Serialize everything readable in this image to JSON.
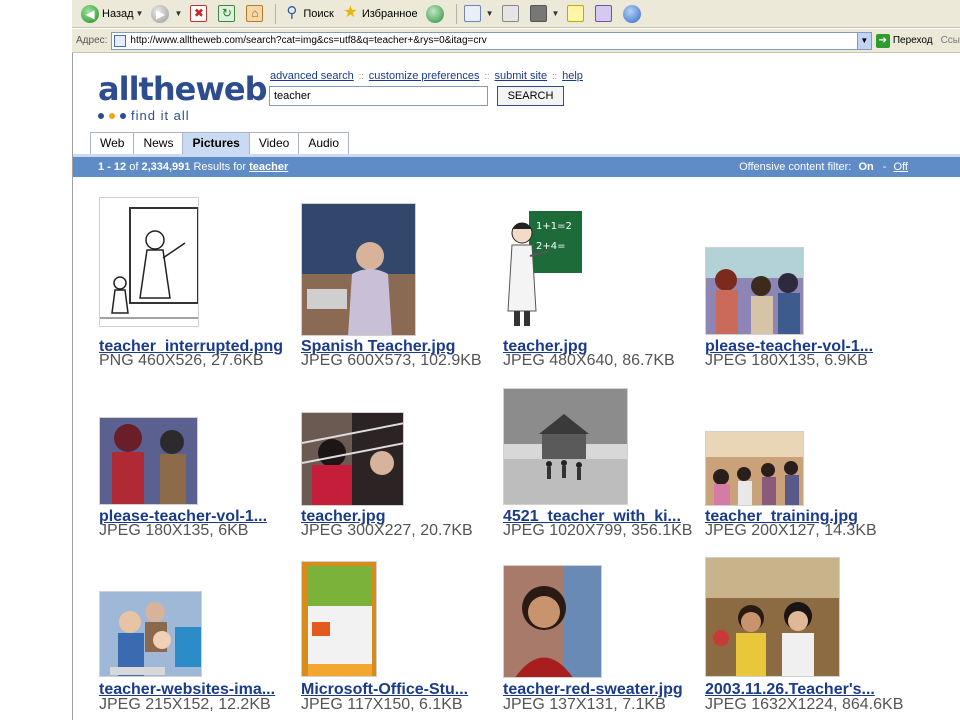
{
  "browser": {
    "back_label": "Назад",
    "search_label": "Поиск",
    "favorites_label": "Избранное",
    "address_label": "Адрес:",
    "url": "http://www.alltheweb.com/search?cat=img&cs=utf8&q=teacher+&rys=0&itag=crv",
    "go_label": "Переход",
    "links_label": "Ссы"
  },
  "header": {
    "logo_text": "alltheweb",
    "tagline": "find it all",
    "links": [
      "advanced search",
      "customize preferences",
      "submit site",
      "help"
    ],
    "search_value": "teacher",
    "search_button": "SEARCH"
  },
  "tabs": [
    {
      "label": "Web",
      "active": false
    },
    {
      "label": "News",
      "active": false
    },
    {
      "label": "Pictures",
      "active": true
    },
    {
      "label": "Video",
      "active": false
    },
    {
      "label": "Audio",
      "active": false
    }
  ],
  "resultbar": {
    "range": "1 - 12",
    "of_text": "of",
    "total": "2,334,991",
    "results_for": "Results for",
    "query": "teacher",
    "filter_label": "Offensive content filter:",
    "filter_on": "On",
    "filter_dash": "-",
    "filter_off": "Off"
  },
  "colors": {
    "brand": "#2d4d8f",
    "result_bar": "#5f8bc7",
    "tab_active": "#c9daf2",
    "link": "#1a3b8b"
  },
  "results": [
    {
      "name": "teacher_interrupted.png",
      "meta": "PNG 460X526, 27.6KB"
    },
    {
      "name": "Spanish Teacher.jpg",
      "meta": "JPEG 600X573, 102.9KB"
    },
    {
      "name": "teacher.jpg",
      "meta": "JPEG 480X640, 86.7KB"
    },
    {
      "name": "please-teacher-vol-1...",
      "meta": "JPEG 180X135, 6.9KB"
    },
    {
      "name": "please-teacher-vol-1...",
      "meta": "JPEG 180X135, 6KB"
    },
    {
      "name": "teacher.jpg",
      "meta": "JPEG 300X227, 20.7KB"
    },
    {
      "name": "4521_teacher_with_ki...",
      "meta": "JPEG 1020X799, 356.1KB"
    },
    {
      "name": "teacher_training.jpg",
      "meta": "JPEG 200X127, 14.3KB"
    },
    {
      "name": "teacher-websites-ima...",
      "meta": "JPEG 215X152, 12.2KB"
    },
    {
      "name": "Microsoft-Office-Stu...",
      "meta": "JPEG 117X150, 6.1KB"
    },
    {
      "name": "teacher-red-sweater.jpg",
      "meta": "JPEG 137X131, 7.1KB"
    },
    {
      "name": "2003.11.26.Teacher's...",
      "meta": "JPEG 1632X1224, 864.6KB"
    }
  ]
}
